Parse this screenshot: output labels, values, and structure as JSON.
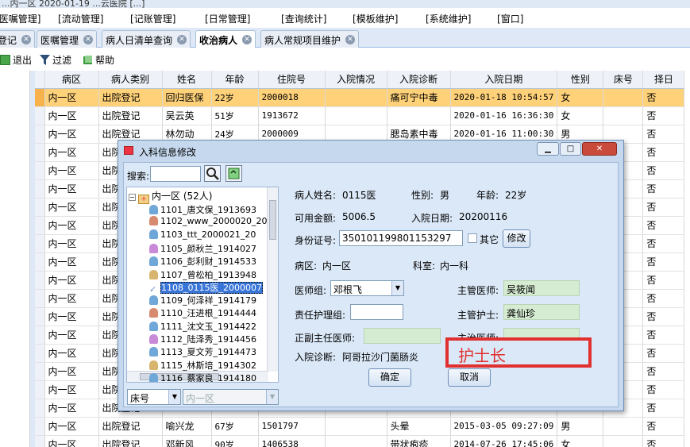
{
  "title_bar": {
    "text": "...内一区 2020-01-19 ...云医院 [...]"
  },
  "menu": [
    "医嘱管理",
    "流动管理",
    "记账管理",
    "日常管理",
    "查询统计",
    "模板维护",
    "系统维护",
    "窗口"
  ],
  "tabs": [
    {
      "label": "登记"
    },
    {
      "label": "医嘱管理"
    },
    {
      "label": "病人日清单查询"
    },
    {
      "label": "收治病人",
      "active": true
    },
    {
      "label": "病人常规项目维护"
    }
  ],
  "toolbar": {
    "exit_label": "退出",
    "filter_label": "过滤",
    "help_label": "帮助"
  },
  "grid": {
    "columns": [
      "病区",
      "病人类别",
      "姓名",
      "年龄",
      "住院号",
      "入院情况",
      "入院诊断",
      "入院日期",
      "性别",
      "床号",
      "择日"
    ],
    "rows": [
      [
        "内一区",
        "出院登记",
        "回归医保",
        "22岁",
        "2000018",
        "",
        "痛可宁中毒",
        "2020-01-18 10:54:57",
        "女",
        "",
        "否"
      ],
      [
        "内一区",
        "出院登记",
        "吴云英",
        "51岁",
        "1913672",
        "",
        "",
        "2020-01-16 16:36:30",
        "女",
        "",
        "否"
      ],
      [
        "内一区",
        "出院登记",
        "林勿动",
        "24岁",
        "2000009",
        "",
        "腮岛素中毒",
        "2020-01-16 11:00:30",
        "男",
        "",
        "否"
      ],
      [
        "内一区",
        "出院登记",
        "",
        "",
        "",
        "",
        "",
        "",
        "",
        "",
        "否"
      ],
      [
        "内一区",
        "出院登记",
        "",
        "",
        "",
        "",
        "",
        "",
        "",
        "",
        "否"
      ],
      [
        "内一区",
        "出院登记",
        "",
        "",
        "",
        "",
        "",
        "",
        "",
        "",
        "否"
      ],
      [
        "内一区",
        "出院登记",
        "",
        "",
        "",
        "",
        "",
        "",
        "",
        "",
        "否"
      ],
      [
        "内一区",
        "出院登记",
        "",
        "",
        "",
        "",
        "",
        "",
        "",
        "",
        "否"
      ],
      [
        "内一区",
        "出院登记",
        "",
        "",
        "",
        "",
        "",
        "",
        "",
        "",
        "否"
      ],
      [
        "内一区",
        "出院登记",
        "",
        "",
        "",
        "",
        "",
        "",
        "",
        "",
        "否"
      ],
      [
        "内一区",
        "出院登记",
        "",
        "",
        "",
        "",
        "",
        "",
        "",
        "",
        "否"
      ],
      [
        "内一区",
        "出院登记",
        "",
        "",
        "",
        "",
        "",
        "",
        "",
        "",
        "否"
      ],
      [
        "内一区",
        "出院登记",
        "",
        "",
        "",
        "",
        "",
        "",
        "",
        "",
        "否"
      ],
      [
        "内一区",
        "出院登记",
        "",
        "",
        "",
        "",
        "",
        "",
        "",
        "",
        "否"
      ],
      [
        "内一区",
        "出院登记",
        "",
        "",
        "",
        "",
        "",
        "",
        "",
        "",
        "否"
      ],
      [
        "内一区",
        "出院登记",
        "",
        "",
        "",
        "",
        "",
        "",
        "",
        "",
        "否"
      ],
      [
        "内一区",
        "出院登记",
        "",
        "",
        "",
        "",
        "",
        "",
        "",
        "",
        "否"
      ],
      [
        "内一区",
        "出院登记",
        "",
        "",
        "",
        "",
        "",
        "",
        "",
        "",
        "否"
      ],
      [
        "内一区",
        "出院登记",
        "喻兴龙",
        "67岁",
        "1501797",
        "",
        "头晕",
        "2015-03-05 09:27:09",
        "男",
        "",
        "否"
      ],
      [
        "内一区",
        "出院登记",
        "邓新风",
        "90岁",
        "1406538",
        "",
        "带状疱疹",
        "2014-07-26 17:45:06",
        "女",
        "",
        "否"
      ]
    ]
  },
  "dialog": {
    "title": "入科信息修改",
    "search_label": "搜索:",
    "tree_root": "内一区 (52人)",
    "tree_items": [
      "1101_唐文保_1913693",
      "1102_www_2000020_20",
      "1103_ttt_2000021_20",
      "1105_颜秋兰_1914027",
      "1106_彭利财_1914533",
      "1107_曾松柏_1913948",
      "1108_0115医_2000007",
      "1109_何泽祥_1914179",
      "1110_汪进根_1914444",
      "1111_沈文玉_1914422",
      "1112_陆泽秀_1914456",
      "1113_夏文芳_1914473",
      "1115_林斯培_1914302",
      "1116_蔡家良_1914180"
    ],
    "sort_combo": "床号",
    "ward_combo": "内一区",
    "patient_name_label": "病人姓名:",
    "patient_name": "0115医",
    "gender_label": "性别:",
    "gender": "男",
    "age_label": "年龄:",
    "age": "22岁",
    "balance_label": "可用金额:",
    "balance": "5006.5",
    "admit_date_label": "入院日期:",
    "admit_date": "20200116",
    "id_label": "身份证号:",
    "id_value": "350101199801153297",
    "other_label": "其它",
    "modify_label": "修改",
    "ward_label": "病区:",
    "ward": "内一区",
    "dept_label": "科室:",
    "dept": "内一科",
    "doctor_group_label": "医师组:",
    "doctor_group": "邓根飞",
    "attending_label": "主管医师:",
    "attending": "吴筱闻",
    "resp_nurse_group_label": "责任护理组:",
    "resp_nurse_group": "",
    "chief_nurse_label": "主管护士:",
    "chief_nurse": "龚仙珍",
    "director_label": "正副主任医师:",
    "director": "",
    "main_doctor_label": "主治医师:",
    "main_doctor": "",
    "diagnosis_label": "入院诊断:",
    "diagnosis": "阿哥拉沙门菌肠炎",
    "head_nurse_label": "护士长",
    "ok_label": "确定",
    "cancel_label": "取消"
  },
  "colors": {
    "selected_row": "#ffd27a",
    "dialog_bg": "#c5d8ee",
    "highlight_red": "#e03030",
    "green_field": "#d6ecd2"
  }
}
